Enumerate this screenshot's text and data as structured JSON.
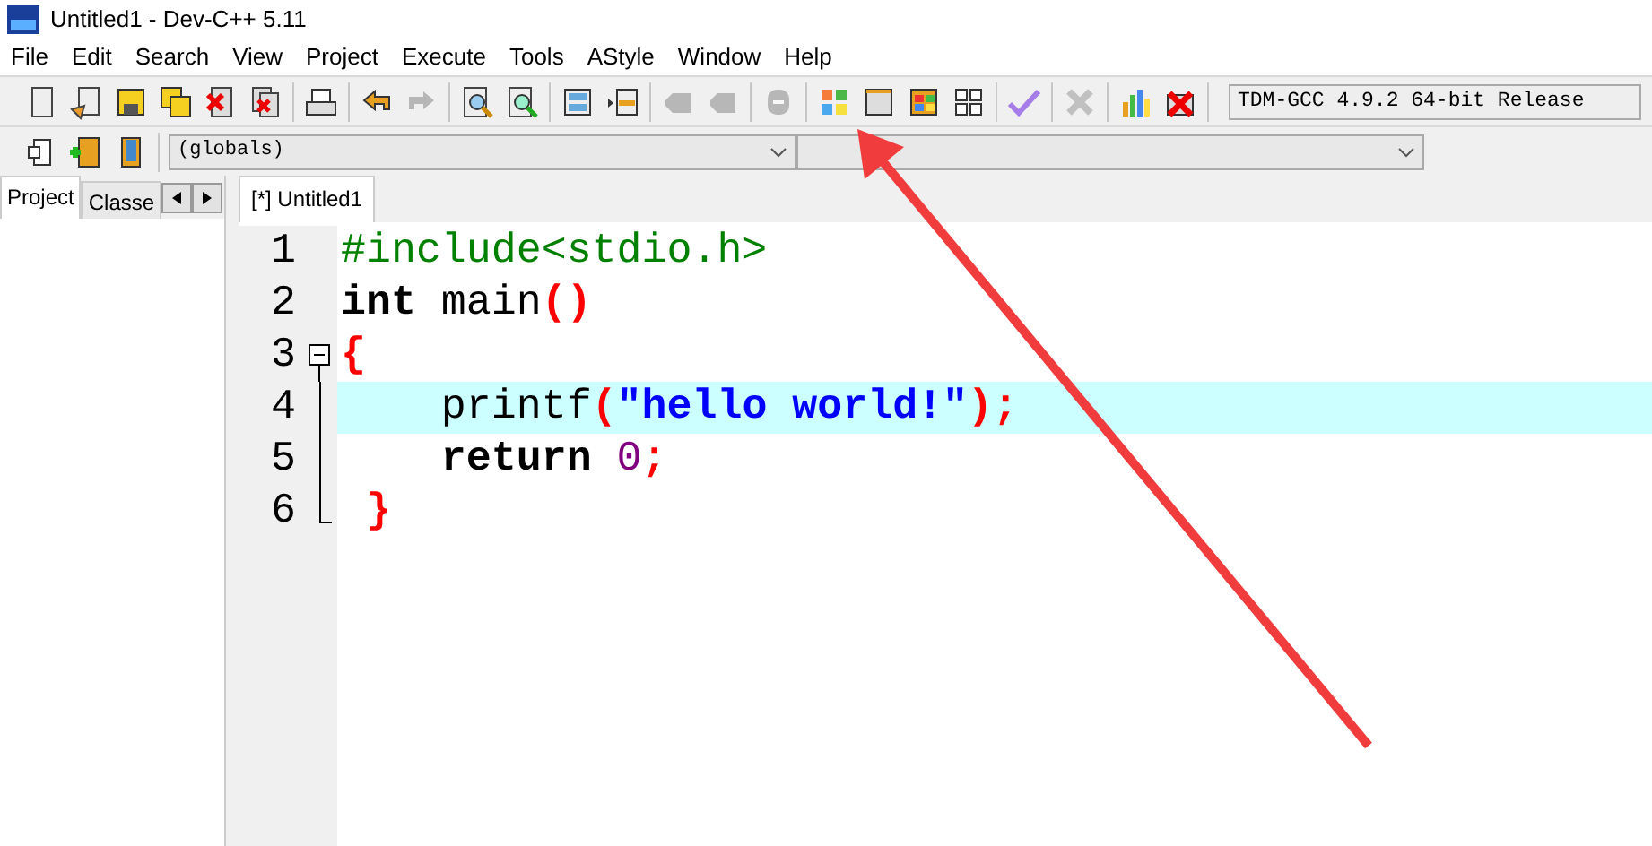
{
  "window": {
    "title": "Untitled1 - Dev-C++ 5.11"
  },
  "menu": [
    "File",
    "Edit",
    "Search",
    "View",
    "Project",
    "Execute",
    "Tools",
    "AStyle",
    "Window",
    "Help"
  ],
  "toolbar": [
    [
      {
        "disabled": false
      },
      {
        "disabled": false
      },
      {
        "disabled": false
      },
      {
        "disabled": false
      },
      {
        "disabled": false
      },
      {
        "disabled": false
      }
    ],
    [
      {
        "disabled": false
      }
    ],
    [
      {
        "disabled": false
      },
      {
        "disabled": true
      }
    ],
    [
      {
        "disabled": false
      },
      {
        "disabled": false
      }
    ],
    [
      {
        "disabled": false
      },
      {
        "disabled": false
      }
    ],
    [
      {
        "disabled": true
      },
      {
        "disabled": true
      }
    ],
    [
      {
        "disabled": true
      }
    ],
    [
      {
        "disabled": false
      },
      {
        "disabled": false
      },
      {
        "disabled": false
      },
      {
        "disabled": false
      }
    ],
    [
      {
        "disabled": false
      }
    ],
    [
      {
        "disabled": true
      }
    ],
    [
      {
        "disabled": false
      },
      {
        "disabled": false
      }
    ]
  ],
  "compiler": {
    "value": "TDM-GCC 4.9.2 64-bit Release"
  },
  "toolbar2": [
    {
      "disabled": false
    },
    {
      "disabled": false
    },
    {
      "disabled": false
    }
  ],
  "scope_combo": {
    "value": "(globals)"
  },
  "side_tabs": [
    {
      "label": "Project",
      "selected": true
    },
    {
      "label": "Classe",
      "selected": false
    }
  ],
  "editor_tabs": [
    {
      "label": "[*] Untitled1",
      "selected": true
    }
  ],
  "code": [
    {
      "number": "1",
      "current": false,
      "tokens": [
        {
          "kind": "preproc",
          "text": "#include<stdio.h>"
        }
      ]
    },
    {
      "number": "2",
      "current": false,
      "tokens": [
        {
          "kind": "keyword",
          "text": "int"
        },
        {
          "kind": "plain",
          "text": " main"
        },
        {
          "kind": "symbol",
          "text": "()"
        }
      ]
    },
    {
      "number": "3",
      "current": false,
      "fold_expanded": true,
      "tokens": [
        {
          "kind": "symbol",
          "text": "{"
        }
      ]
    },
    {
      "number": "4",
      "current": true,
      "tokens": [
        {
          "kind": "plain",
          "text": "    printf"
        },
        {
          "kind": "symbol",
          "text": "("
        },
        {
          "kind": "string",
          "text": "\"hello world!\""
        },
        {
          "kind": "symbol",
          "text": ");"
        }
      ]
    },
    {
      "number": "5",
      "current": false,
      "tokens": [
        {
          "kind": "keyword",
          "text": "    return"
        },
        {
          "kind": "number",
          "text": " 0"
        },
        {
          "kind": "symbol",
          "text": ";"
        }
      ]
    },
    {
      "number": "6",
      "current": false,
      "tokens": [
        {
          "kind": "symbol",
          "text": " }"
        }
      ]
    }
  ]
}
